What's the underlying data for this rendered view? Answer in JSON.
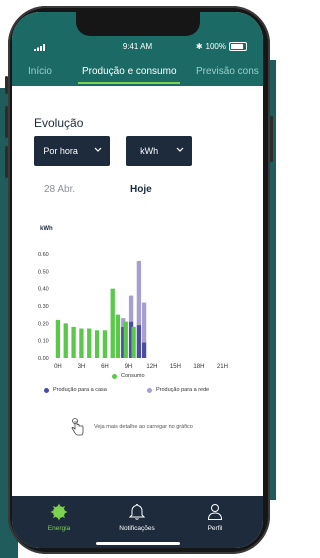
{
  "status_bar": {
    "time": "9:41 AM",
    "battery": "100%"
  },
  "tabs": [
    {
      "label": "Início"
    },
    {
      "label": "Produção e consumo"
    },
    {
      "label": "Previsão cons"
    }
  ],
  "section": {
    "title": "Evolução"
  },
  "selectors": {
    "period": "Por hora",
    "unit": "kWh"
  },
  "dates": {
    "previous": "28 Abr.",
    "current": "Hoje"
  },
  "chart_data": {
    "type": "bar",
    "ylabel": "kWh",
    "ylim": [
      0,
      0.6
    ],
    "y_ticks": [
      "0.00",
      "0.10",
      "0.20",
      "0.30",
      "0.40",
      "0.50",
      "0.60"
    ],
    "x_ticks": [
      "0H",
      "3H",
      "6H",
      "9H",
      "12H",
      "15H",
      "18H",
      "21H"
    ],
    "hours": [
      0,
      1,
      2,
      3,
      4,
      5,
      6,
      7,
      8,
      9,
      10,
      11
    ],
    "series": [
      {
        "name": "Consumo",
        "color": "#5cc84b",
        "values": [
          0.22,
          0.2,
          0.18,
          0.17,
          0.17,
          0.16,
          0.16,
          0.4,
          0.25,
          0.21,
          0.18,
          null
        ]
      },
      {
        "name": "Produção para a casa",
        "color": "#4b4e9e",
        "values": [
          null,
          null,
          null,
          null,
          null,
          null,
          null,
          null,
          0.18,
          0.21,
          0.19,
          0.09
        ]
      },
      {
        "name": "Produção para a rede",
        "color": "#a79ed1",
        "values": [
          null,
          null,
          null,
          null,
          null,
          null,
          null,
          null,
          0.05,
          0.15,
          0.37,
          0.23
        ]
      }
    ]
  },
  "legend": {
    "consumo": "Consumo",
    "casa": "Produção para a casa",
    "rede": "Produção para a rede"
  },
  "hint": {
    "text": "Veja mais detalhe ao carregar no gráfico"
  },
  "nav": [
    {
      "label": "Energia"
    },
    {
      "label": "Notificações"
    },
    {
      "label": "Perfil"
    }
  ],
  "colors": {
    "header": "#1b6a66",
    "accent": "#7fd24f",
    "navy": "#1d2b3d"
  }
}
